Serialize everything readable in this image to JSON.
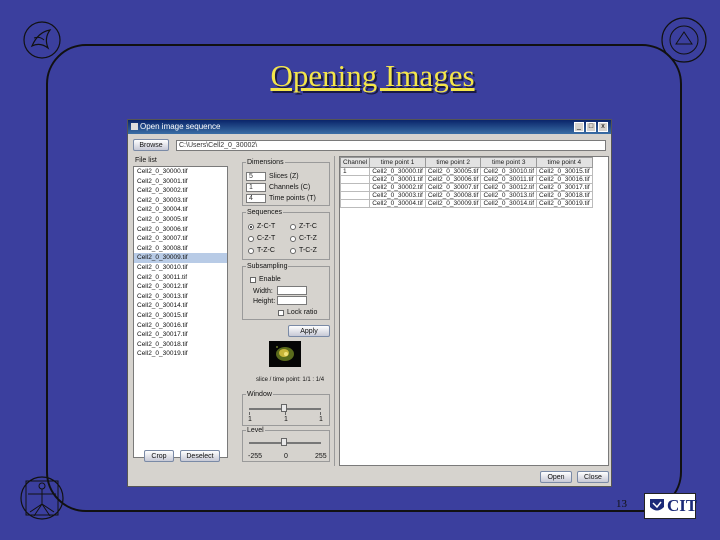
{
  "slide": {
    "title": "Opening Images",
    "page_number": "13",
    "cit_logo_text": "CIT"
  },
  "window": {
    "title": "Open image sequence",
    "browse_label": "Browse",
    "path_value": "C:\\Users\\Cell2_0_30002\\"
  },
  "file_list": {
    "header": "File list",
    "selected_index": 9,
    "items": [
      "Cell2_0_30000.tif",
      "Cell2_0_30001.tif",
      "Cell2_0_30002.tif",
      "Cell2_0_30003.tif",
      "Cell2_0_30004.tif",
      "Cell2_0_30005.tif",
      "Cell2_0_30006.tif",
      "Cell2_0_30007.tif",
      "Cell2_0_30008.tif",
      "Cell2_0_30009.tif",
      "Cell2_0_30010.tif",
      "Cell2_0_30011.tif",
      "Cell2_0_30012.tif",
      "Cell2_0_30013.tif",
      "Cell2_0_30014.tif",
      "Cell2_0_30015.tif",
      "Cell2_0_30016.tif",
      "Cell2_0_30017.tif",
      "Cell2_0_30018.tif",
      "Cell2_0_30019.tif"
    ],
    "crop_label": "Crop",
    "deselect_label": "Deselect"
  },
  "dimensions": {
    "header": "Dimensions",
    "rows": [
      {
        "value": "5",
        "label": "Slices (Z)"
      },
      {
        "value": "1",
        "label": "Channels (C)"
      },
      {
        "value": "4",
        "label": "Time points (T)"
      }
    ]
  },
  "sequences": {
    "header": "Sequences",
    "options": [
      "Z-C-T",
      "Z-T-C",
      "C-Z-T",
      "C-T-Z",
      "T-Z-C",
      "T-C-Z"
    ],
    "selected": "Z-C-T"
  },
  "subsampling": {
    "header": "Subsampling",
    "enable_label": "Enable",
    "width_label": "Width:",
    "height_label": "Height:",
    "lock_label": "Lock ratio",
    "apply_label": "Apply"
  },
  "preview": {
    "caption": "slice / time point: 1/1 : 1/4"
  },
  "window_level": {
    "window_header": "Window",
    "window_ticks": [
      "1",
      "1",
      "1"
    ],
    "level_header": "Level",
    "level_min": "-255",
    "level_mid": "0",
    "level_max": "255"
  },
  "sequence_table": {
    "columns": [
      "Channel",
      "time point 1",
      "time point 2",
      "time point 3",
      "time point 4"
    ],
    "rows": [
      [
        "1",
        "Cell2_0_30000.tif",
        "Cell2_0_30005.tif",
        "Cell2_0_30010.tif",
        "Cell2_0_30015.tif"
      ],
      [
        "",
        "Cell2_0_30001.tif",
        "Cell2_0_30006.tif",
        "Cell2_0_30011.tif",
        "Cell2_0_30016.tif"
      ],
      [
        "",
        "Cell2_0_30002.tif",
        "Cell2_0_30007.tif",
        "Cell2_0_30012.tif",
        "Cell2_0_30017.tif"
      ],
      [
        "",
        "Cell2_0_30003.tif",
        "Cell2_0_30008.tif",
        "Cell2_0_30013.tif",
        "Cell2_0_30018.tif"
      ],
      [
        "",
        "Cell2_0_30004.tif",
        "Cell2_0_30009.tif",
        "Cell2_0_30014.tif",
        "Cell2_0_30019.tif"
      ]
    ]
  },
  "footer": {
    "open_label": "Open",
    "close_label": "Close"
  }
}
